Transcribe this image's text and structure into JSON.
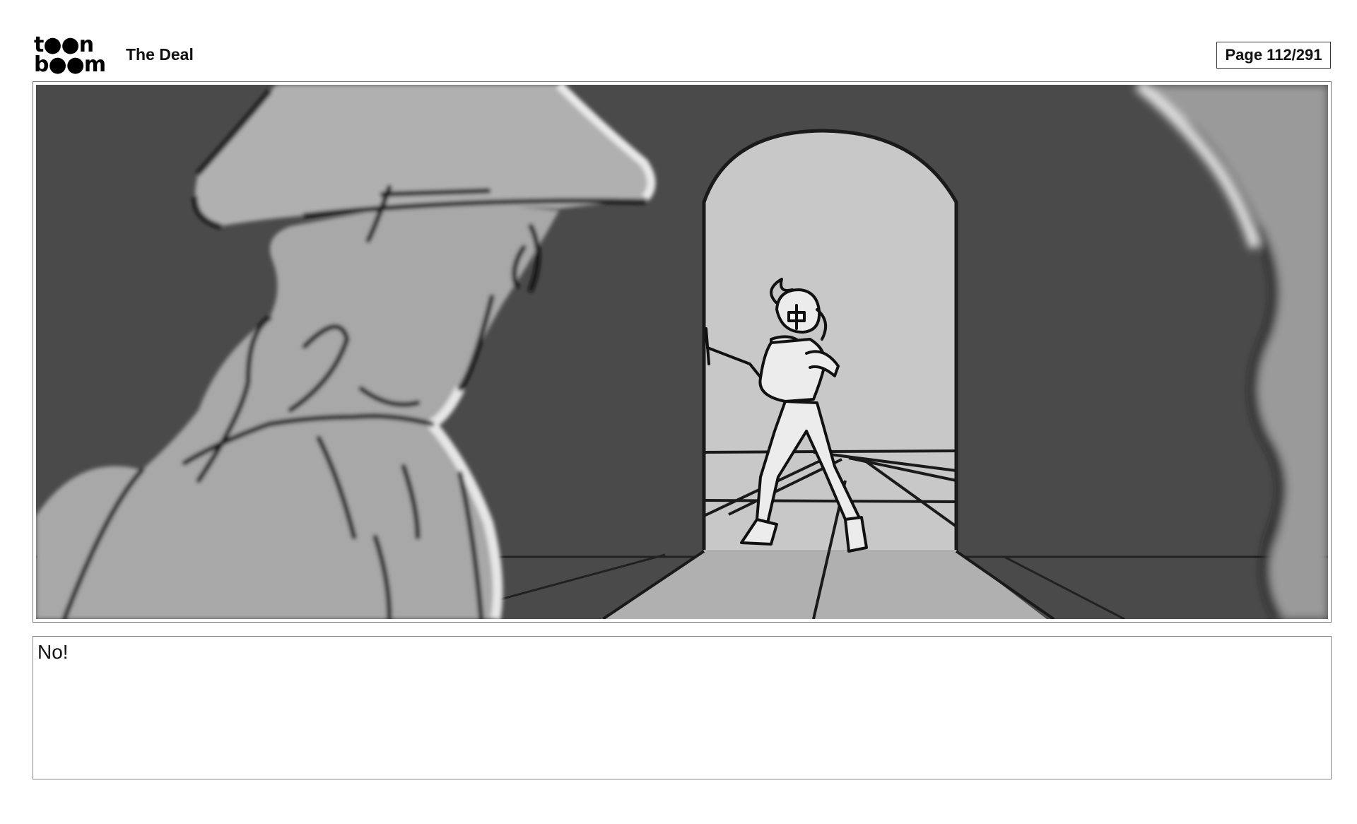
{
  "header": {
    "logo_line1": "t●●n",
    "logo_line2": "b●●m",
    "project_title": "The Deal",
    "page_indicator": "Page 112/291"
  },
  "panel": {
    "caption": "No!"
  },
  "colors": {
    "wall": "#4a4a4a",
    "doorway_light": "#c8c8c8",
    "floor_light": "#b0b0b0",
    "foreground_figure": "#a8a8a8",
    "ink": "#1a1a1a"
  }
}
